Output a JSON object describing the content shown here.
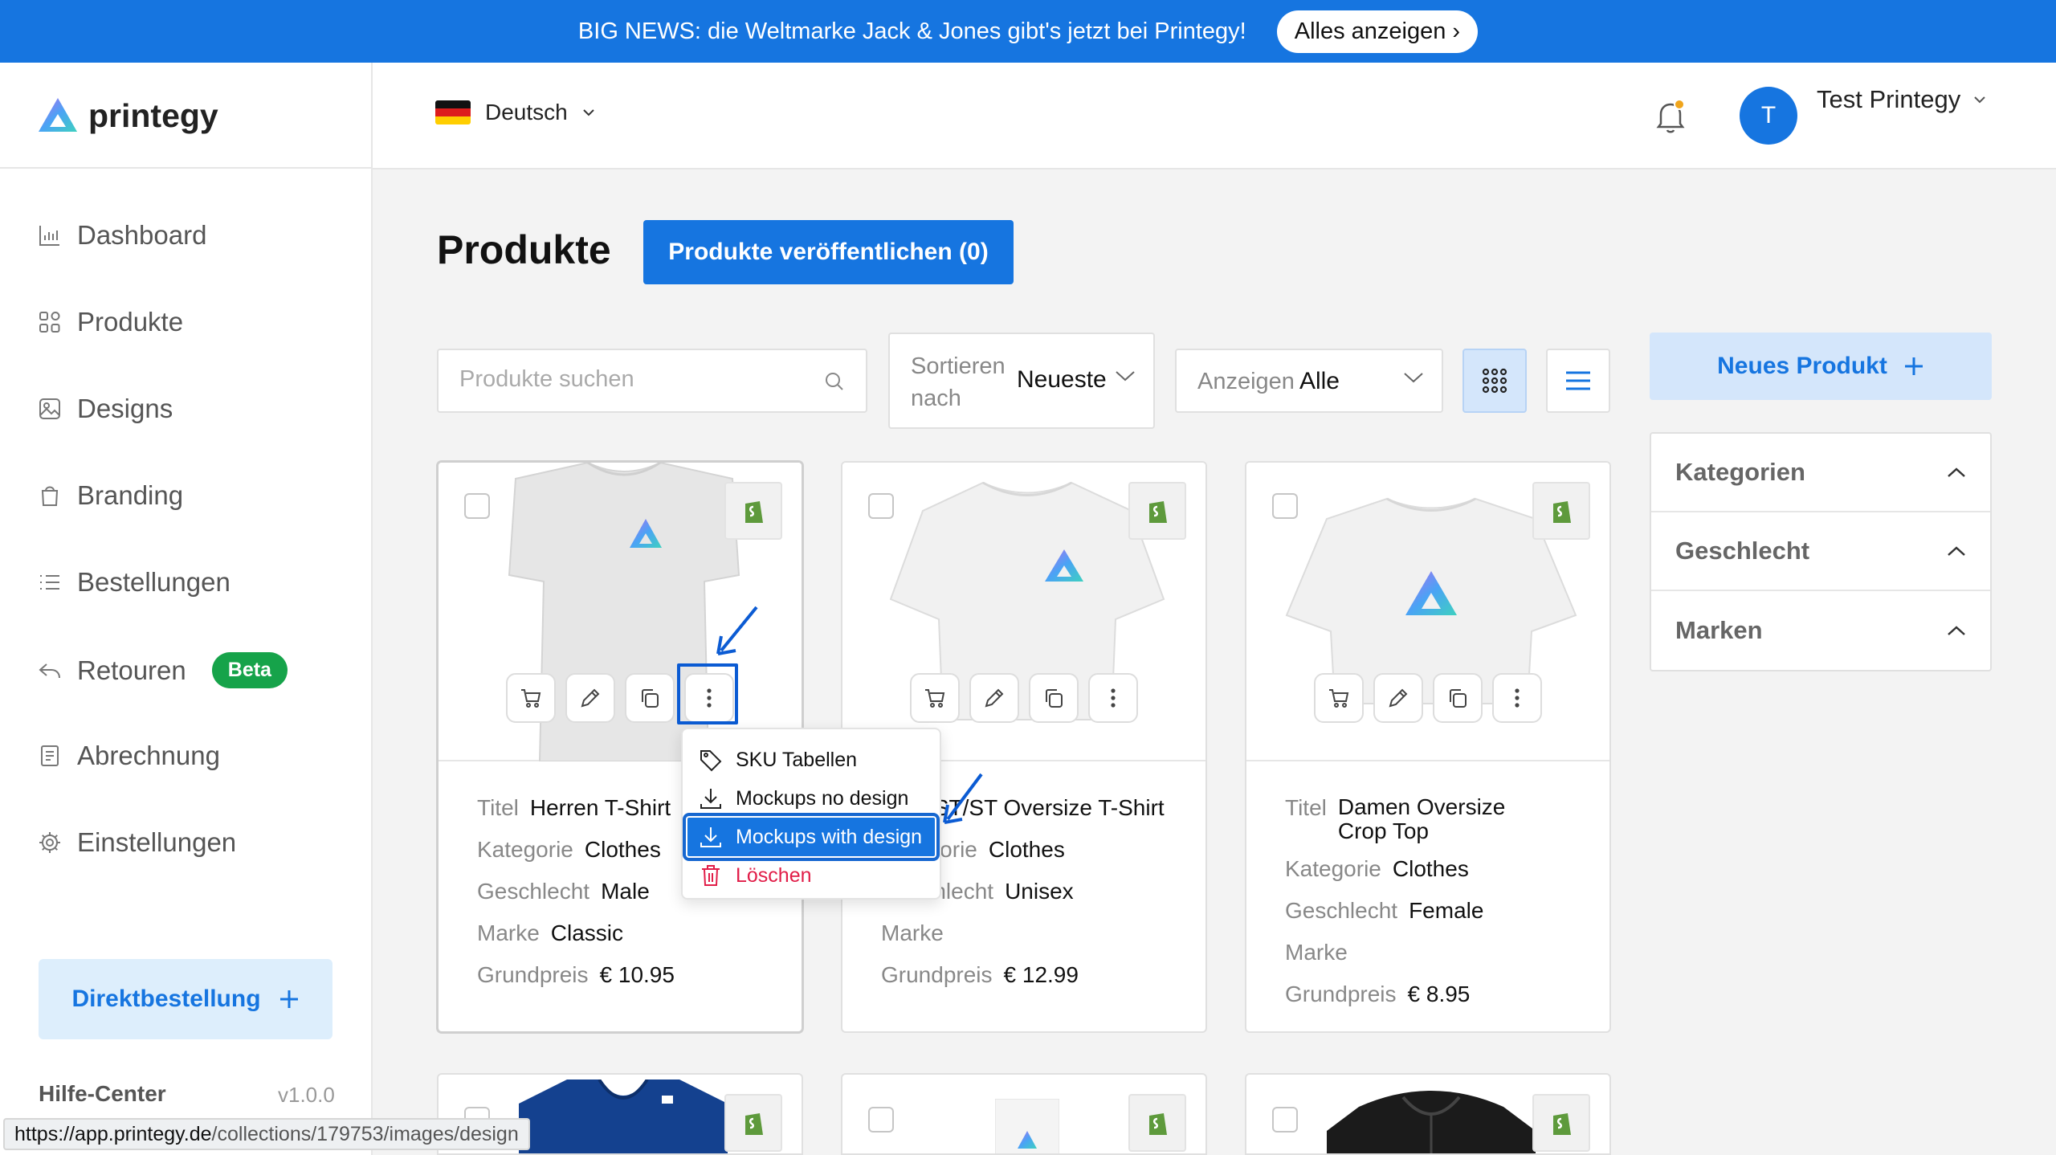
{
  "banner": {
    "text": "BIG NEWS: die Weltmarke Jack & Jones gibt's jetzt bei Printegy!",
    "button_label": "Alles anzeigen ›",
    "color": "#1675e0"
  },
  "brand": {
    "name": "printegy"
  },
  "header": {
    "language": "Deutsch",
    "user_initial": "T",
    "user_name": "Test Printegy"
  },
  "sidebar": {
    "items": [
      {
        "label": "Dashboard",
        "icon": "chart-icon"
      },
      {
        "label": "Produkte",
        "icon": "grid-icon"
      },
      {
        "label": "Designs",
        "icon": "image-icon"
      },
      {
        "label": "Branding",
        "icon": "bag-icon"
      },
      {
        "label": "Bestellungen",
        "icon": "list-icon"
      },
      {
        "label": "Retouren",
        "icon": "return-icon",
        "badge": "Beta"
      },
      {
        "label": "Abrechnung",
        "icon": "receipt-icon"
      },
      {
        "label": "Einstellungen",
        "icon": "gear-icon"
      }
    ],
    "direct_order_label": "Direktbestellung",
    "help_label": "Hilfe-Center",
    "version": "v1.0.0"
  },
  "main": {
    "title": "Produkte",
    "publish_button": "Produkte veröffentlichen (0)",
    "search_placeholder": "Produkte suchen",
    "sort_label": "Sortieren nach",
    "sort_value": "Neueste",
    "show_label": "Anzeigen",
    "show_value": "Alle",
    "new_product_label": "Neues Produkt",
    "filters": [
      "Kategorien",
      "Geschlecht",
      "Marken"
    ]
  },
  "labels": {
    "title": "Titel",
    "category": "Kategorie",
    "gender": "Geschlecht",
    "brand": "Marke",
    "base_price": "Grundpreis"
  },
  "products": [
    {
      "title": "Herren T-Shirt",
      "category": "Clothes",
      "gender": "Male",
      "brand": "Classic",
      "price": "€ 10.95"
    },
    {
      "title": "ST/ST Oversize T-Shirt",
      "category": "Clothes",
      "gender": "Unisex",
      "brand": "",
      "price": "€ 12.99"
    },
    {
      "title": "Damen Oversize Crop Top",
      "category": "Clothes",
      "gender": "Female",
      "brand": "",
      "price": "€ 8.95"
    }
  ],
  "context_menu": {
    "items": [
      {
        "label": "SKU Tabellen",
        "icon": "tag-icon"
      },
      {
        "label": "Mockups no design",
        "icon": "download-icon"
      },
      {
        "label": "Mockups with design",
        "icon": "download-icon",
        "selected": true
      },
      {
        "label": "Löschen",
        "icon": "trash-icon",
        "danger": true
      }
    ]
  },
  "statusbar": {
    "host": "https://app.printegy.de",
    "path": "/collections/179753/images/design"
  }
}
